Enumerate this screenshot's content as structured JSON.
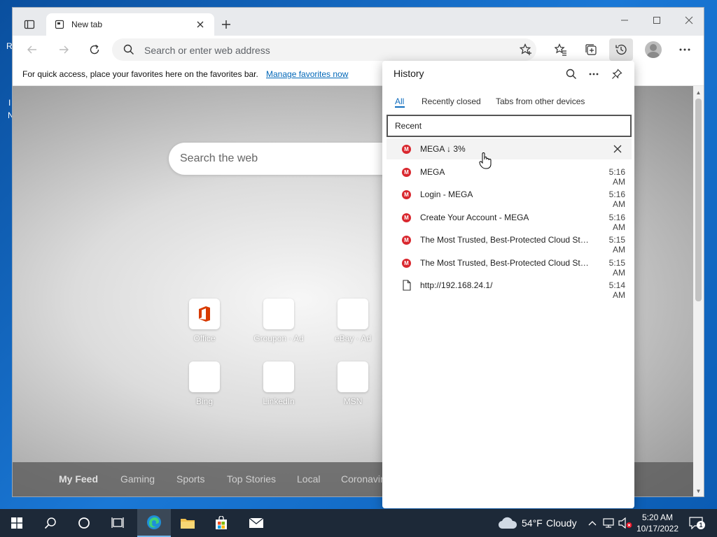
{
  "desktop": {
    "frag_left_1": "R",
    "frag_left_2": "I",
    "frag_left_3": "N"
  },
  "browser": {
    "tab_title": "New tab",
    "address_placeholder": "Search or enter web address",
    "favorites_bar": {
      "message": "For quick access, place your favorites here on the favorites bar.",
      "link": "Manage favorites now"
    }
  },
  "newtab": {
    "search_placeholder": "Search the web",
    "tiles": [
      {
        "label": "Office"
      },
      {
        "label": "Groupon · Ad"
      },
      {
        "label": "eBay · Ad"
      },
      {
        "label": "Bing"
      },
      {
        "label": "LinkedIn"
      },
      {
        "label": "MSN"
      }
    ],
    "feed_tabs": [
      "My Feed",
      "Gaming",
      "Sports",
      "Top Stories",
      "Local",
      "Coronavir"
    ]
  },
  "history": {
    "title": "History",
    "tabs": [
      "All",
      "Recently closed",
      "Tabs from other devices"
    ],
    "section": "Recent",
    "items": [
      {
        "title": "MEGA ↓ 3%",
        "time": "",
        "icon": "mega-icon"
      },
      {
        "title": "MEGA",
        "time": "5:16 AM",
        "icon": "mega-icon"
      },
      {
        "title": "Login - MEGA",
        "time": "5:16 AM",
        "icon": "mega-icon"
      },
      {
        "title": "Create Your Account - MEGA",
        "time": "5:16 AM",
        "icon": "mega-icon"
      },
      {
        "title": "The Most Trusted, Best-Protected Cloud Stor...",
        "time": "5:15 AM",
        "icon": "mega-icon"
      },
      {
        "title": "The Most Trusted, Best-Protected Cloud Stor...",
        "time": "5:15 AM",
        "icon": "mega-icon"
      },
      {
        "title": "http://192.168.24.1/",
        "time": "5:14 AM",
        "icon": "page-icon"
      }
    ]
  },
  "taskbar": {
    "weather_temp": "54°F",
    "weather_text": "Cloudy",
    "time": "5:20 AM",
    "date": "10/17/2022",
    "notification_count": "1"
  },
  "colors": {
    "accent": "#0f6cbd",
    "mega_red": "#d9272e",
    "taskbar": "#1d2938"
  }
}
